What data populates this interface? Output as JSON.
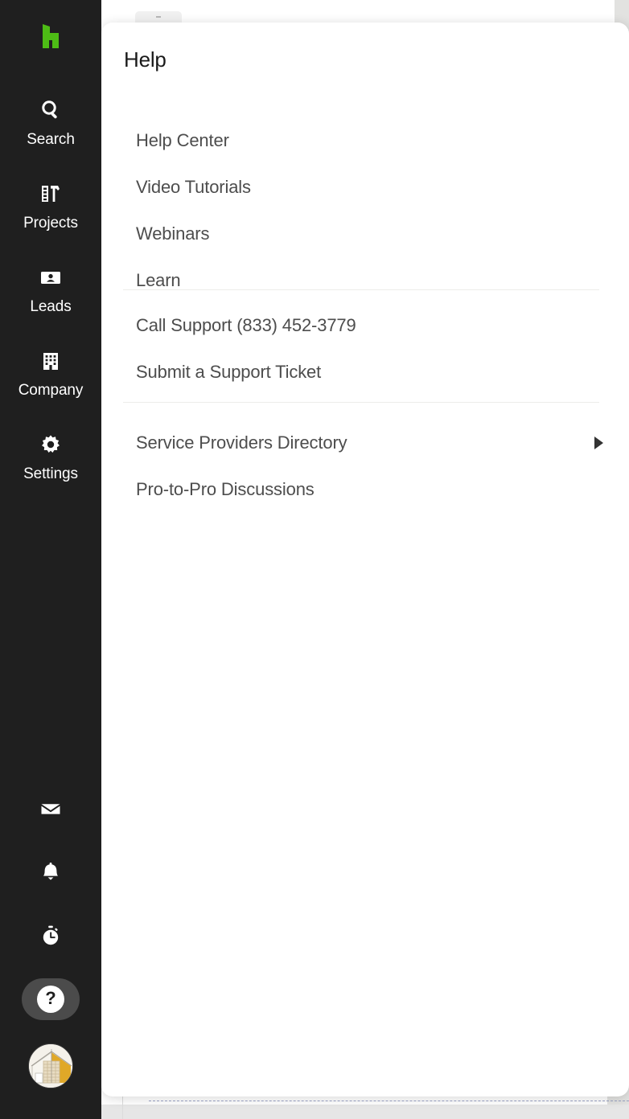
{
  "app": {
    "brand_logo": "houzz-h-logo",
    "accent_green": "#4DBC15",
    "sidebar_bg": "#1F1F1F",
    "panel_bg": "#FFFFFF"
  },
  "sidebar": {
    "nav_items": [
      {
        "label": "Search",
        "icon": "search-icon"
      },
      {
        "label": "Projects",
        "icon": "ruler-hammer-icon"
      },
      {
        "label": "Leads",
        "icon": "contact-card-icon"
      },
      {
        "label": "Company",
        "icon": "building-icon"
      },
      {
        "label": "Settings",
        "icon": "gear-icon"
      }
    ],
    "utility_items": [
      {
        "name": "messages",
        "icon": "envelope-icon"
      },
      {
        "name": "notifications",
        "icon": "bell-icon"
      },
      {
        "name": "time-tracking",
        "icon": "stopwatch-icon"
      },
      {
        "name": "help",
        "icon": "question-mark-icon",
        "glyph": "?",
        "active": true
      }
    ],
    "avatar": {
      "name": "user-avatar",
      "icon": "house-avatar-image"
    }
  },
  "help_panel": {
    "title": "Help",
    "groups": [
      {
        "name": "resources",
        "items": [
          {
            "label": "Help Center"
          },
          {
            "label": "Video Tutorials"
          },
          {
            "label": "Webinars"
          },
          {
            "label": "Learn"
          }
        ]
      },
      {
        "name": "support",
        "items": [
          {
            "label": "Call Support (833) 452-3779"
          },
          {
            "label": "Submit a Support Ticket"
          }
        ]
      },
      {
        "name": "community",
        "items": [
          {
            "label": "Service Providers Directory",
            "submenu": true
          },
          {
            "label": "Pro-to-Pro Discussions"
          }
        ]
      }
    ]
  },
  "background": {
    "accent_chip_color": "#DCA62F",
    "partial_glyph": ")"
  }
}
